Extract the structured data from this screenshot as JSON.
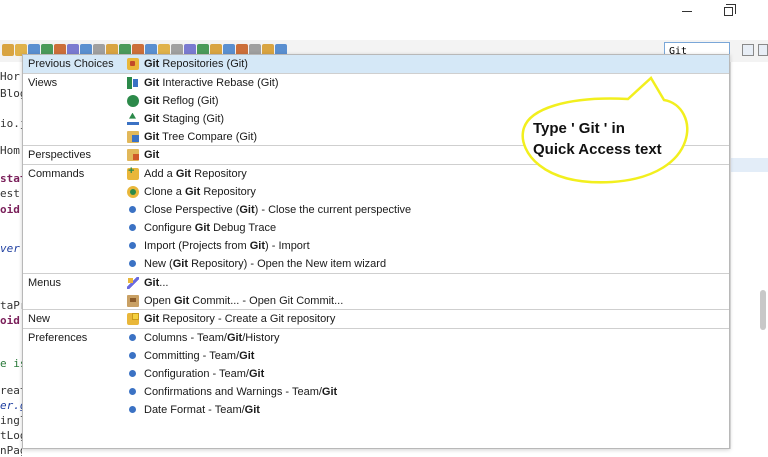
{
  "window": {
    "minimize_glyph": "",
    "maximize_glyph": ""
  },
  "toolbar": {
    "quick_access_value": "Git"
  },
  "editor": {
    "lines": [
      {
        "text": "Hor",
        "top": 0
      },
      {
        "text": "Blog",
        "top": 0
      },
      {
        "text": "io.j",
        "top": 0
      },
      {
        "text": "Hom",
        "top": 0
      },
      {
        "text": "stat",
        "top": 0
      },
      {
        "text": "est",
        "top": 0
      },
      {
        "text": "oid",
        "top": 0
      },
      {
        "text": "ver",
        "top": 0
      },
      {
        "text": "taPr",
        "top": 0
      },
      {
        "text": "oid",
        "top": 0
      },
      {
        "text": "e is",
        "top": 0
      },
      {
        "text": "reat",
        "top": 0
      },
      {
        "text": "er.g",
        "top": 0
      },
      {
        "text": "ingl",
        "top": 0
      },
      {
        "text": "tLog",
        "top": 0
      },
      {
        "text": "nPag",
        "top": 0
      }
    ]
  },
  "quick_access": {
    "sections": [
      {
        "category": "Previous Choices",
        "items": [
          {
            "icon": "git-repositories-icon",
            "parts": [
              {
                "t": "Git",
                "b": true
              },
              {
                "t": " Repositories (Git)",
                "b": false
              }
            ],
            "selected": true
          }
        ]
      },
      {
        "category": "Views",
        "items": [
          {
            "icon": "git-interactive-rebase-icon",
            "parts": [
              {
                "t": "Git",
                "b": true
              },
              {
                "t": " Interactive Rebase (Git)",
                "b": false
              }
            ]
          },
          {
            "icon": "git-reflog-icon",
            "parts": [
              {
                "t": "Git",
                "b": true
              },
              {
                "t": " Reflog (Git)",
                "b": false
              }
            ]
          },
          {
            "icon": "git-staging-icon",
            "parts": [
              {
                "t": "Git",
                "b": true
              },
              {
                "t": " Staging (Git)",
                "b": false
              }
            ]
          },
          {
            "icon": "git-tree-compare-icon",
            "parts": [
              {
                "t": "Git",
                "b": true
              },
              {
                "t": " Tree Compare (Git)",
                "b": false
              }
            ]
          }
        ]
      },
      {
        "category": "Perspectives",
        "items": [
          {
            "icon": "git-perspective-icon",
            "parts": [
              {
                "t": "Git",
                "b": true
              }
            ]
          }
        ]
      },
      {
        "category": "Commands",
        "items": [
          {
            "icon": "add-git-repository-icon",
            "parts": [
              {
                "t": "Add a ",
                "b": false
              },
              {
                "t": "Git",
                "b": true
              },
              {
                "t": " Repository",
                "b": false
              }
            ]
          },
          {
            "icon": "clone-git-repository-icon",
            "parts": [
              {
                "t": "Clone a ",
                "b": false
              },
              {
                "t": "Git",
                "b": true
              },
              {
                "t": " Repository",
                "b": false
              }
            ]
          },
          {
            "icon": "command-dot-icon",
            "parts": [
              {
                "t": "Close Perspective (",
                "b": false
              },
              {
                "t": "Git",
                "b": true
              },
              {
                "t": ") - Close the current perspective",
                "b": false
              }
            ]
          },
          {
            "icon": "command-dot-icon",
            "parts": [
              {
                "t": "Configure ",
                "b": false
              },
              {
                "t": "Git",
                "b": true
              },
              {
                "t": " Debug Trace",
                "b": false
              }
            ]
          },
          {
            "icon": "command-dot-icon",
            "parts": [
              {
                "t": "Import (Projects from ",
                "b": false
              },
              {
                "t": "Git",
                "b": true
              },
              {
                "t": ") - Import",
                "b": false
              }
            ]
          },
          {
            "icon": "command-dot-icon",
            "parts": [
              {
                "t": "New (",
                "b": false
              },
              {
                "t": "Git",
                "b": true
              },
              {
                "t": " Repository) - Open the New item wizard",
                "b": false
              }
            ]
          }
        ]
      },
      {
        "category": "Menus",
        "items": [
          {
            "icon": "git-menu-icon",
            "parts": [
              {
                "t": "Git",
                "b": true
              },
              {
                "t": "...",
                "b": false
              }
            ]
          },
          {
            "icon": "open-git-commit-icon",
            "parts": [
              {
                "t": "Open ",
                "b": false
              },
              {
                "t": "Git",
                "b": true
              },
              {
                "t": " Commit... - Open Git Commit...",
                "b": false
              }
            ]
          }
        ]
      },
      {
        "category": "New",
        "items": [
          {
            "icon": "new-git-repository-icon",
            "parts": [
              {
                "t": "Git",
                "b": true
              },
              {
                "t": " Repository - Create a Git repository",
                "b": false
              }
            ]
          }
        ]
      },
      {
        "category": "Preferences",
        "items": [
          {
            "icon": "preference-dot-icon",
            "parts": [
              {
                "t": "Columns - Team/",
                "b": false
              },
              {
                "t": "Git",
                "b": true
              },
              {
                "t": "/History",
                "b": false
              }
            ]
          },
          {
            "icon": "preference-dot-icon",
            "parts": [
              {
                "t": "Committing - Team/",
                "b": false
              },
              {
                "t": "Git",
                "b": true
              }
            ]
          },
          {
            "icon": "preference-dot-icon",
            "parts": [
              {
                "t": "Configuration - Team/",
                "b": false
              },
              {
                "t": "Git",
                "b": true
              }
            ]
          },
          {
            "icon": "preference-dot-icon",
            "parts": [
              {
                "t": "Confirmations and Warnings - Team/",
                "b": false
              },
              {
                "t": "Git",
                "b": true
              }
            ]
          },
          {
            "icon": "preference-dot-icon",
            "parts": [
              {
                "t": "Date Format - Team/",
                "b": false
              },
              {
                "t": "Git",
                "b": true
              }
            ]
          }
        ]
      }
    ]
  },
  "annotation": {
    "line1": "Type ' Git ' in",
    "line2": "Quick Access text",
    "color": "#f2ef1e"
  }
}
